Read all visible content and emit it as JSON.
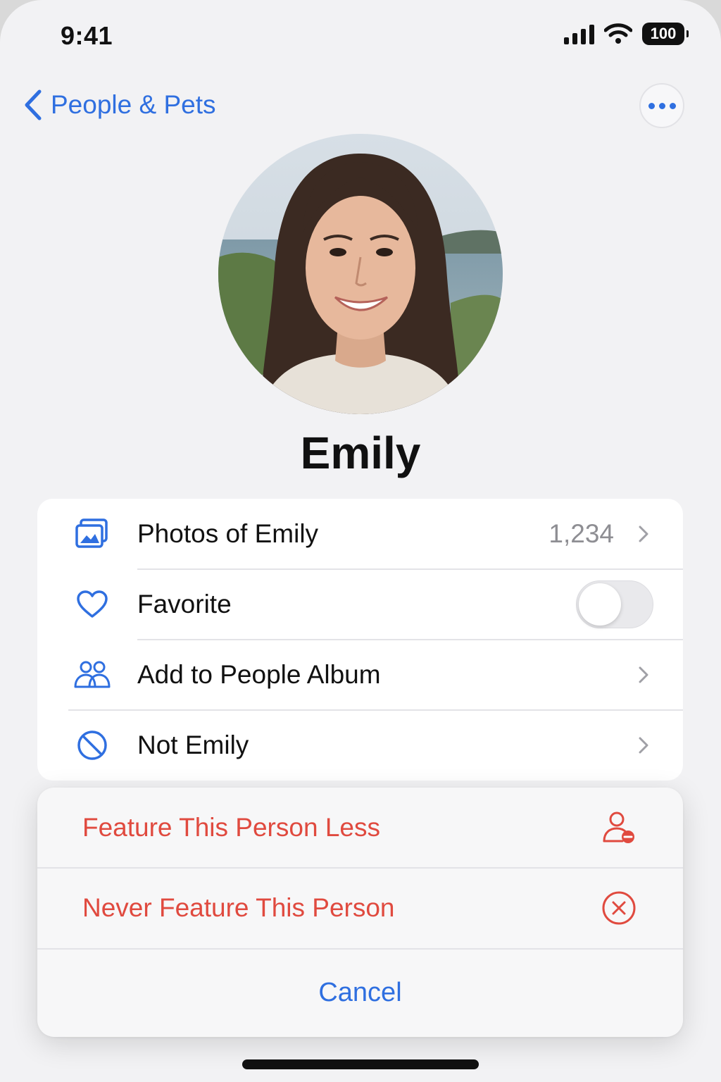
{
  "status_bar": {
    "time": "9:41",
    "battery": "100"
  },
  "nav": {
    "back_label": "People & Pets"
  },
  "person": {
    "name": "Emily"
  },
  "list": {
    "photos_label": "Photos of Emily",
    "photos_count": "1,234",
    "favorite_label": "Favorite",
    "favorite_on": false,
    "add_album_label": "Add to People Album",
    "not_person_label": "Not Emily"
  },
  "action_sheet": {
    "feature_less_label": "Feature This Person Less",
    "never_feature_label": "Never Feature This Person",
    "cancel_label": "Cancel"
  },
  "colors": {
    "accent": "#2f6fe0",
    "destructive": "#e04a3f",
    "background": "#f2f2f4"
  }
}
